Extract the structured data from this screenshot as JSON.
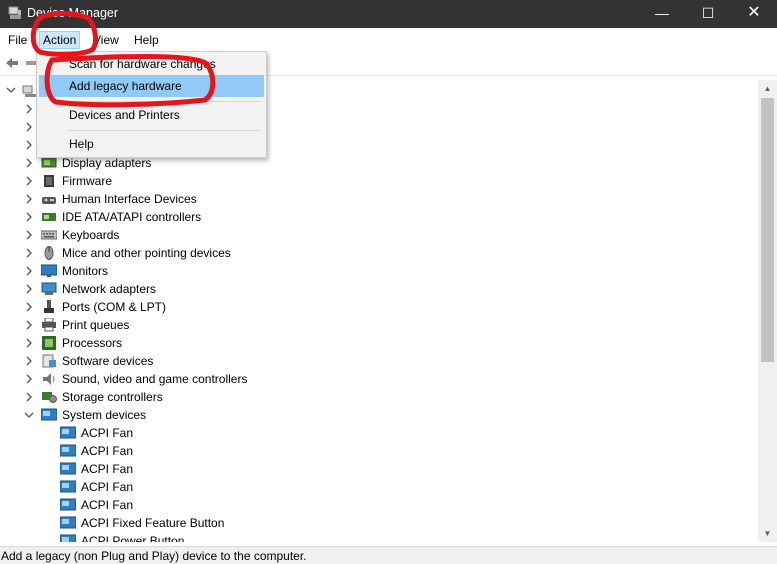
{
  "window": {
    "title": "Device Manager",
    "minimize_glyph": "—",
    "maximize_glyph": "☐",
    "close_glyph": "✕"
  },
  "menubar": {
    "items": [
      {
        "label": "File"
      },
      {
        "label": "Action"
      },
      {
        "label": "View"
      },
      {
        "label": "Help"
      }
    ]
  },
  "action_menu": {
    "items": [
      {
        "label": "Scan for hardware changes"
      },
      {
        "label": "Add legacy hardware"
      },
      {
        "label": "Devices and Printers"
      },
      {
        "label": "Help"
      }
    ],
    "highlighted_index": 1
  },
  "tree": {
    "categories": [
      {
        "label": "Display adapters",
        "icon": "display-adapter-icon",
        "expanded": false
      },
      {
        "label": "Firmware",
        "icon": "firmware-chip-icon",
        "expanded": false
      },
      {
        "label": "Human Interface Devices",
        "icon": "hid-icon",
        "expanded": false
      },
      {
        "label": "IDE ATA/ATAPI controllers",
        "icon": "ide-controller-icon",
        "expanded": false
      },
      {
        "label": "Keyboards",
        "icon": "keyboard-icon",
        "expanded": false
      },
      {
        "label": "Mice and other pointing devices",
        "icon": "mouse-icon",
        "expanded": false
      },
      {
        "label": "Monitors",
        "icon": "monitor-icon",
        "expanded": false
      },
      {
        "label": "Network adapters",
        "icon": "network-adapter-icon",
        "expanded": false
      },
      {
        "label": "Ports (COM & LPT)",
        "icon": "port-icon",
        "expanded": false
      },
      {
        "label": "Print queues",
        "icon": "printer-icon",
        "expanded": false
      },
      {
        "label": "Processors",
        "icon": "processor-icon",
        "expanded": false
      },
      {
        "label": "Software devices",
        "icon": "software-device-icon",
        "expanded": false
      },
      {
        "label": "Sound, video and game controllers",
        "icon": "speaker-icon",
        "expanded": false
      },
      {
        "label": "Storage controllers",
        "icon": "storage-controller-icon",
        "expanded": false
      },
      {
        "label": "System devices",
        "icon": "system-device-icon",
        "expanded": true
      }
    ],
    "system_devices": [
      {
        "label": "ACPI Fan"
      },
      {
        "label": "ACPI Fan"
      },
      {
        "label": "ACPI Fan"
      },
      {
        "label": "ACPI Fan"
      },
      {
        "label": "ACPI Fan"
      },
      {
        "label": "ACPI Fixed Feature Button"
      },
      {
        "label": "ACPI Power Button"
      }
    ]
  },
  "statusbar": {
    "text": "Add a legacy (non Plug and Play) device to the computer."
  },
  "colors": {
    "titlebar_bg": "#333333",
    "menu_highlight": "#91c9f7",
    "annotation_red": "#e8141c"
  }
}
